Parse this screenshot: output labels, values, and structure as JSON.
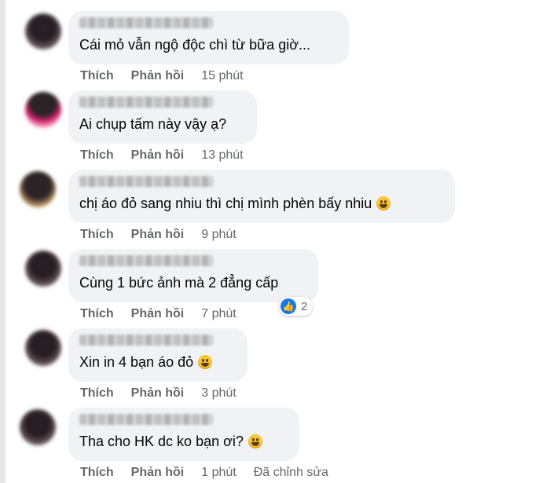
{
  "actions": {
    "like": "Thích",
    "reply": "Phản hồi"
  },
  "comments": [
    {
      "text": "Cái mỏ vẫn ngộ độc chì từ bữa giờ...",
      "time": "15 phút",
      "emoji": ""
    },
    {
      "text": "Ai chụp tấm này vậy ạ?",
      "time": "13 phút",
      "emoji": ""
    },
    {
      "text": "chị áo đỏ sang nhiu thì chị mình phèn bấy nhiu",
      "time": "9 phút",
      "emoji": "laughing-tears-emoji"
    },
    {
      "text": "Cùng 1 bức ảnh mà 2 đẳng cấp",
      "time": "7 phút",
      "emoji": "",
      "reactions": {
        "icon": "like-icon",
        "count": "2"
      }
    },
    {
      "text": "Xin in 4 bạn áo đỏ",
      "time": "3 phút",
      "emoji": "rolling-laughing-emoji"
    },
    {
      "text": "Tha cho HK dc ko bạn ơi?",
      "time": "1 phút",
      "emoji": "smiley-emoji",
      "edited": "Đã chỉnh sửa"
    }
  ],
  "colors": {
    "bubble": "#f0f2f5",
    "meta": "#65676b",
    "like_blue": "#1877f2"
  }
}
